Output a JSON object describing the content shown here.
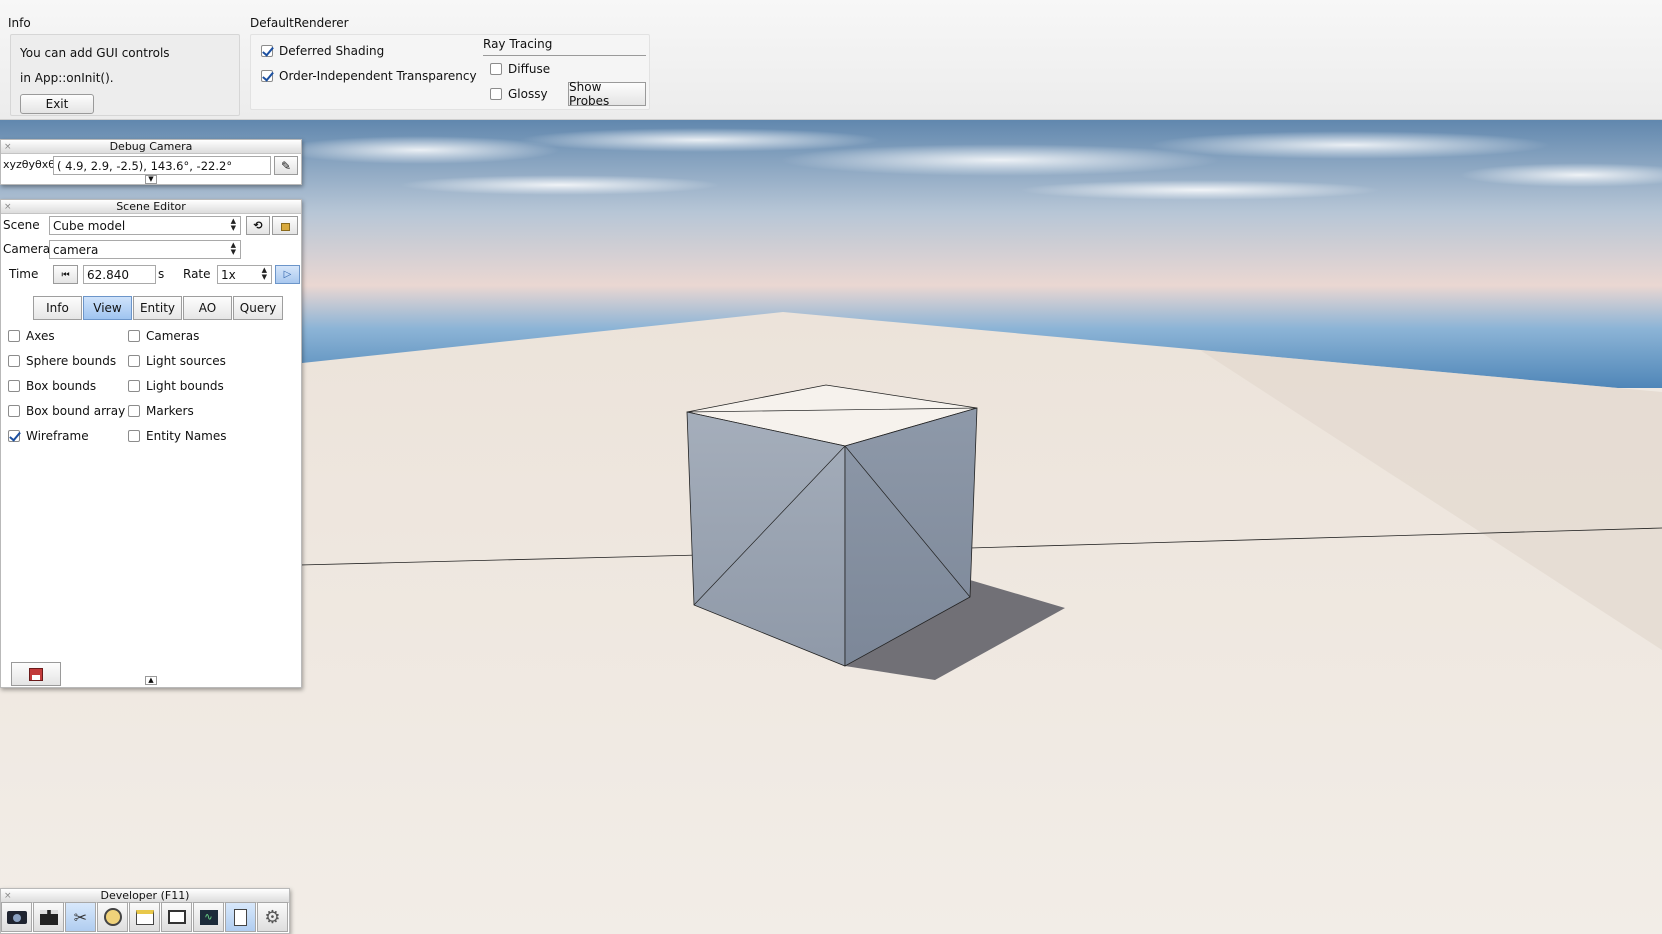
{
  "info_panel": {
    "caption": "Info",
    "line1": "You can add GUI controls",
    "line2": "in App::onInit().",
    "exit_label": "Exit"
  },
  "renderer_panel": {
    "caption": "DefaultRenderer",
    "deferred_shading": {
      "label": "Deferred Shading",
      "checked": true
    },
    "oit": {
      "label": "Order-Independent Transparency",
      "checked": true
    },
    "ray_tracing": {
      "caption": "Ray Tracing",
      "diffuse": {
        "label": "Diffuse",
        "checked": false
      },
      "glossy": {
        "label": "Glossy",
        "checked": false
      },
      "show_probes_label": "Show Probes"
    }
  },
  "debug_camera": {
    "title": "Debug Camera",
    "coord_label": "xyzθyθxθz",
    "coord_value": "(  4.9,   2.9,  -2.5),   143.6°, -22.2°"
  },
  "scene_editor": {
    "title": "Scene Editor",
    "scene_label": "Scene",
    "scene_value": "Cube model",
    "camera_label": "Camera",
    "camera_value": "camera",
    "time_label": "Time",
    "time_value": "62.840",
    "time_unit": "s",
    "rate_label": "Rate",
    "rate_value": "1x",
    "tabs": [
      {
        "label": "Info",
        "active": false
      },
      {
        "label": "View",
        "active": true
      },
      {
        "label": "Entity",
        "active": false
      },
      {
        "label": "AO",
        "active": false
      },
      {
        "label": "Query",
        "active": false
      }
    ],
    "left_options": [
      {
        "label": "Axes",
        "checked": false
      },
      {
        "label": "Sphere bounds",
        "checked": false
      },
      {
        "label": "Box bounds",
        "checked": false
      },
      {
        "label": "Box bound array",
        "checked": false
      },
      {
        "label": "Wireframe",
        "checked": true
      }
    ],
    "right_options": [
      {
        "label": "Cameras",
        "checked": false
      },
      {
        "label": "Light sources",
        "checked": false
      },
      {
        "label": "Light bounds",
        "checked": false
      },
      {
        "label": "Markers",
        "checked": false
      },
      {
        "label": "Entity Names",
        "checked": false
      }
    ]
  },
  "developer": {
    "title": "Developer (F11)",
    "icons": [
      "camera-icon",
      "film-clapper-icon",
      "tools-icon",
      "speedometer-icon",
      "window-icon",
      "video-capture-icon",
      "profiler-icon",
      "log-icon",
      "gear-icon"
    ]
  },
  "colors": {
    "accent_blue": "#9fc4f0",
    "cube_face_left": "#9aa4b2",
    "cube_face_right": "#8f9aaa",
    "cube_top": "#f3efea",
    "ground": "#efe8df"
  }
}
